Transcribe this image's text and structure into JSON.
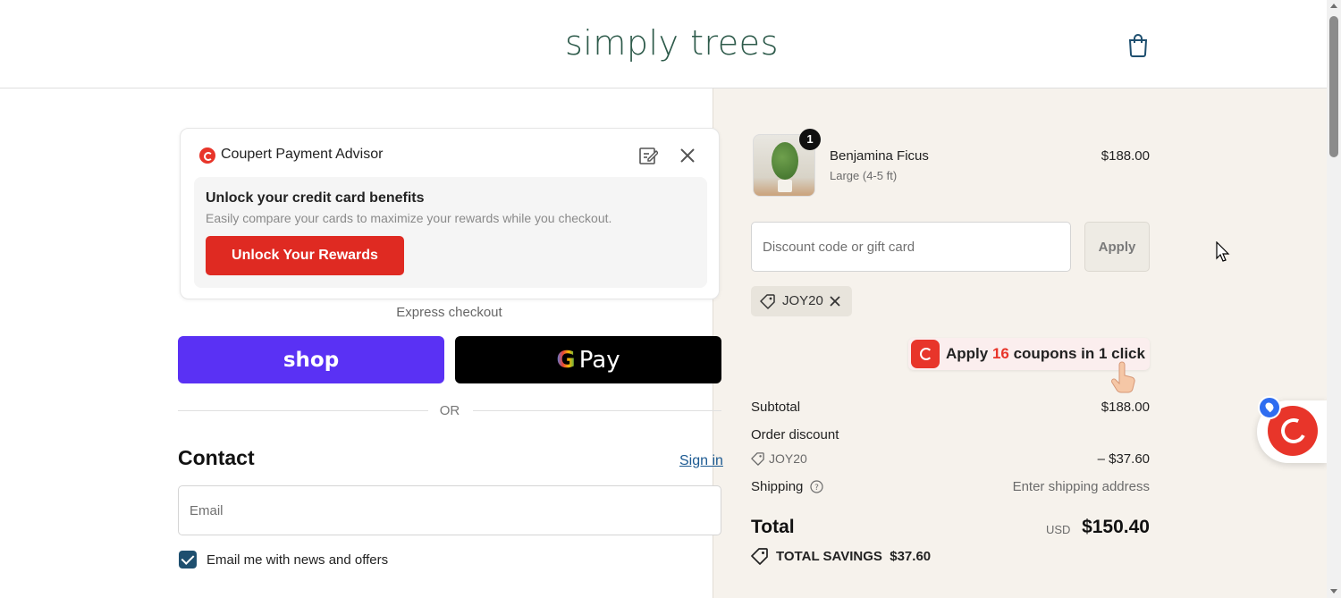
{
  "header": {
    "logo": "simply trees",
    "cart_icon": "shopping-bag-icon"
  },
  "advisor": {
    "title": "Coupert Payment Advisor",
    "heading": "Unlock your credit card benefits",
    "subtext": "Easily compare your cards to maximize your rewards while you checkout.",
    "button_label": "Unlock Your Rewards"
  },
  "express": {
    "label": "Express checkout",
    "shop_label": "shop",
    "gpay_g": "G",
    "gpay_label": "Pay"
  },
  "or_text": "OR",
  "contact": {
    "heading": "Contact",
    "signin_label": "Sign in",
    "email_placeholder": "Email",
    "newsletter_label": "Email me with news and offers",
    "newsletter_checked": true
  },
  "cart": {
    "item": {
      "name": "Benjamina Ficus",
      "variant": "Large (4-5 ft)",
      "price": "$188.00",
      "quantity": "1"
    },
    "discount_placeholder": "Discount code or gift card",
    "apply_label": "Apply",
    "applied_code": "JOY20",
    "coupon_prompt": {
      "prefix": "Apply ",
      "count": "16",
      "suffix": " coupons in 1 click"
    },
    "summary": {
      "subtotal_label": "Subtotal",
      "subtotal_value": "$188.00",
      "order_discount_label": "Order discount",
      "discount_code": "JOY20",
      "discount_value": "– $37.60",
      "shipping_label": "Shipping",
      "shipping_value": "Enter shipping address",
      "total_label": "Total",
      "currency": "USD",
      "total_value": "$150.40",
      "savings_label": "TOTAL SAVINGS",
      "savings_value": "$37.60"
    }
  },
  "colors": {
    "accent": "#1e4f6f",
    "shop": "#5a31f4",
    "coupert": "#e8352a",
    "summary_bg": "#f6f2ec"
  }
}
